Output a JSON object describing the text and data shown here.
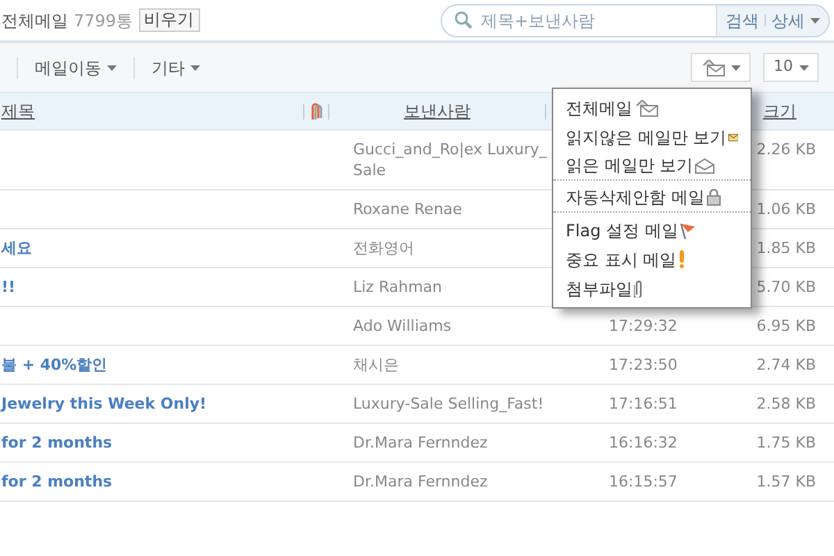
{
  "mailbox": {
    "label": "전체메일",
    "count": "7799통",
    "empty_button": "비우기"
  },
  "search": {
    "placeholder": "제목+보낸사람",
    "button": "검색",
    "detail": "상세"
  },
  "toolbar": {
    "move": "메일이동",
    "more": "기타",
    "page_size": "10"
  },
  "columns": {
    "subject": "제목",
    "sender": "보낸사람",
    "size": "크기"
  },
  "rows": [
    {
      "subject": "",
      "sender": "Gucci_and_Ro|ex Luxury_Sale",
      "time": "",
      "size": "2.26 KB"
    },
    {
      "subject": "",
      "sender": "Roxane Renae",
      "time": "",
      "size": "1.06 KB"
    },
    {
      "subject": "세요",
      "sender": "전화영어",
      "time": "",
      "size": "1.85 KB"
    },
    {
      "subject": "!!",
      "sender": "Liz Rahman",
      "time": "",
      "size": "5.70 KB"
    },
    {
      "subject": "",
      "sender": "Ado Williams",
      "time": "17:29:32",
      "size": "6.95 KB"
    },
    {
      "subject": "불 + 40%할인",
      "sender": "채시은",
      "time": "17:23:50",
      "size": "2.74 KB"
    },
    {
      "subject": "Jewelry this Week Only!",
      "sender": "Luxury-Sale Selling_Fast!",
      "time": "17:16:51",
      "size": "2.58 KB"
    },
    {
      "subject": "for 2 months",
      "sender": "Dr.Mara Fernndez",
      "time": "16:16:32",
      "size": "1.75 KB"
    },
    {
      "subject": "for 2 months",
      "sender": "Dr.Mara Fernndez",
      "time": "16:15:57",
      "size": "1.57 KB"
    }
  ],
  "filter_menu": [
    {
      "label": "전체메일",
      "separator_after": false
    },
    {
      "label": "읽지않은 메일만 보기",
      "separator_after": false
    },
    {
      "label": "읽은 메일만 보기",
      "separator_after": true
    },
    {
      "label": "자동삭제안함 메일",
      "separator_after": true
    },
    {
      "label": "Flag 설정 메일",
      "separator_after": false
    },
    {
      "label": "중요 표시 메일",
      "separator_after": false
    },
    {
      "label": "첨부파일",
      "separator_after": false
    }
  ]
}
